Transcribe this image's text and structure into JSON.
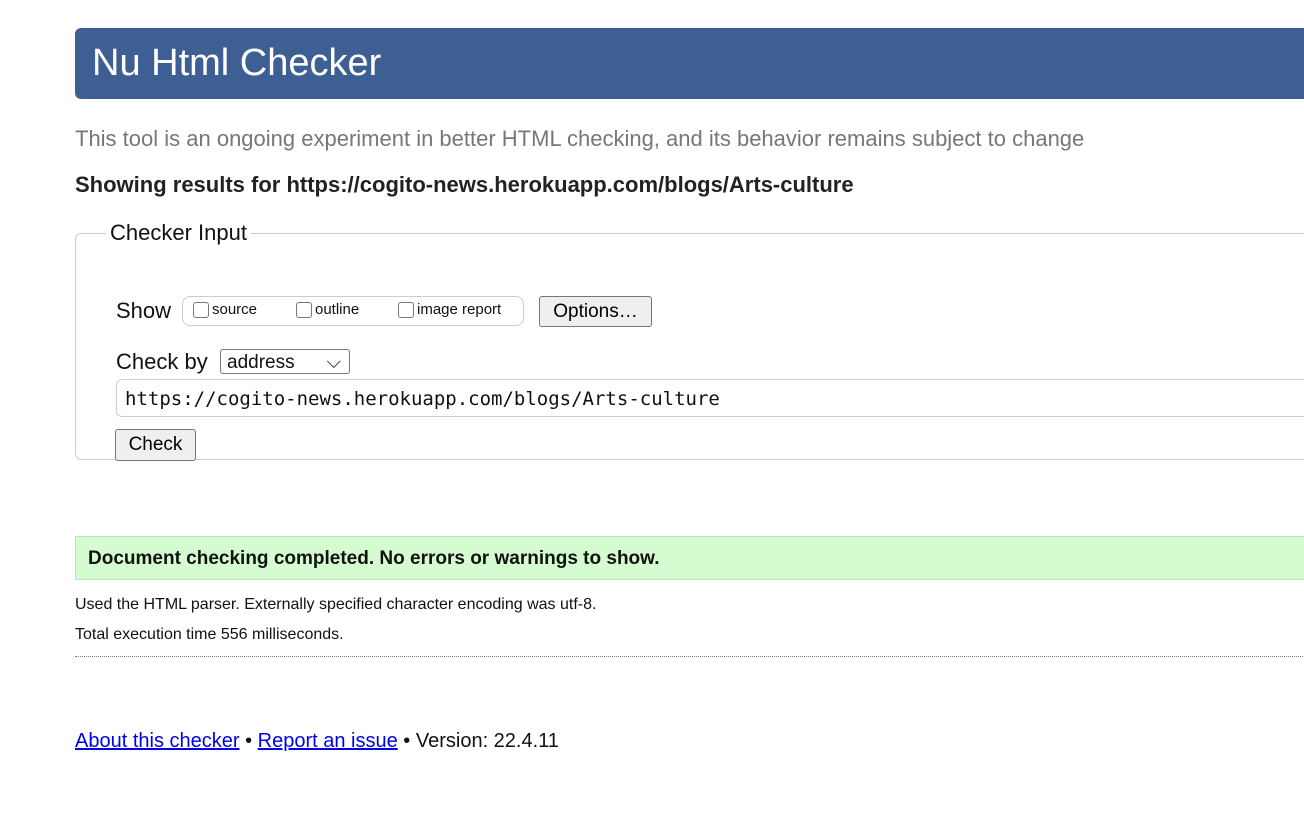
{
  "header": {
    "title": "Nu Html Checker"
  },
  "intro": "This tool is an ongoing experiment in better HTML checking, and its behavior remains subject to change",
  "showing": "Showing results for https://cogito-news.herokuapp.com/blogs/Arts-culture",
  "form": {
    "legend": "Checker Input",
    "show_label": "Show",
    "checkboxes": [
      "source",
      "outline",
      "image report"
    ],
    "options_button": "Options…",
    "check_by_label": "Check by",
    "check_by_value": "address",
    "url": "https://cogito-news.herokuapp.com/blogs/Arts-culture",
    "check_button": "Check"
  },
  "result": {
    "success": "Document checking completed. No errors or warnings to show.",
    "parser": "Used the HTML parser. Externally specified character encoding was utf-8.",
    "time": "Total execution time 556 milliseconds."
  },
  "footer": {
    "about": "About this checker",
    "sep1": " • ",
    "report": "Report an issue",
    "sep2": " • ",
    "version": "Version: 22.4.11"
  }
}
